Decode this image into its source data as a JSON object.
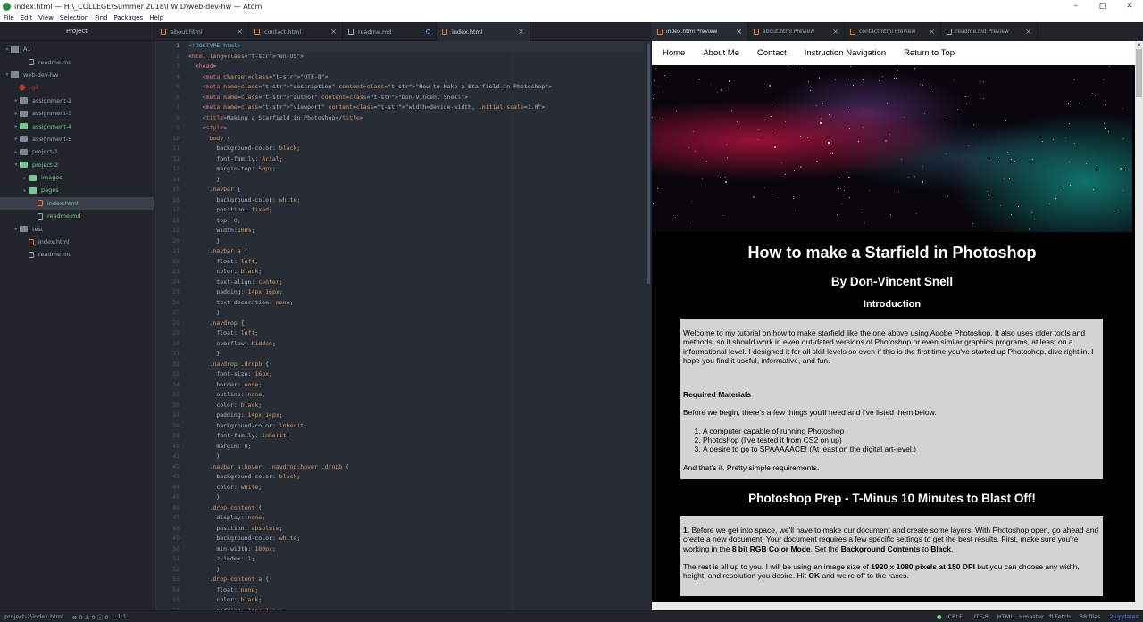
{
  "window": {
    "title": "index.html — H:\\_COLLEGE\\Summer 2018\\I W D\\web-dev-hw — Atom",
    "controls": [
      "–",
      "□",
      "✕"
    ]
  },
  "menu": [
    "File",
    "Edit",
    "View",
    "Selection",
    "Find",
    "Packages",
    "Help"
  ],
  "tree": {
    "header": "Project",
    "rows": [
      {
        "label": "A1",
        "type": "repo",
        "open": true,
        "indent": 0
      },
      {
        "label": "readme.md",
        "type": "file",
        "indent": 2
      },
      {
        "label": "web-dev-hw",
        "type": "repo",
        "open": true,
        "indent": 0
      },
      {
        "label": ".git",
        "type": "gitdir",
        "indent": 1
      },
      {
        "label": "assignment-2",
        "type": "folder",
        "indent": 1
      },
      {
        "label": "assignment-3",
        "type": "folder",
        "indent": 1
      },
      {
        "label": "assignment-4",
        "type": "folder",
        "color": "green",
        "indent": 1
      },
      {
        "label": "assignment-5",
        "type": "folder",
        "indent": 1
      },
      {
        "label": "project-1",
        "type": "folder",
        "indent": 1
      },
      {
        "label": "project-2",
        "type": "folder",
        "color": "green",
        "open": true,
        "indent": 1
      },
      {
        "label": "images",
        "type": "folder",
        "color": "green",
        "indent": 2
      },
      {
        "label": "pages",
        "type": "folder",
        "color": "green",
        "indent": 2
      },
      {
        "label": "index.html",
        "type": "htmlfile",
        "color": "green",
        "selected": true,
        "indent": 3
      },
      {
        "label": "readme.md",
        "type": "file",
        "color": "green",
        "indent": 3
      },
      {
        "label": "test",
        "type": "folder",
        "indent": 1
      },
      {
        "label": "index.html",
        "type": "htmlfile",
        "indent": 2
      },
      {
        "label": "readme.md",
        "type": "file",
        "indent": 2
      }
    ]
  },
  "editor_tabs": [
    {
      "label": "about.html",
      "kind": "html",
      "active": false,
      "modified": false
    },
    {
      "label": "contact.html",
      "kind": "html",
      "active": false,
      "modified": false
    },
    {
      "label": "readme.md",
      "kind": "md",
      "active": false,
      "modified": true
    },
    {
      "label": "index.html",
      "kind": "html",
      "active": true,
      "modified": false
    }
  ],
  "code_lines": [
    "<!DOCTYPE html>",
    "<html lang=\"en-US\">",
    "  <head>",
    "    <meta charset=\"UTF-8\">",
    "    <meta name=\"description\" content=\"How to Make a Starfield in Photoshop\">",
    "    <meta name=\"author\" content=\"Don-Vincent Snell\">",
    "    <meta name=\"viewport\" content=\"width=device-width, initial-scale=1.0\">",
    "    <title>Making a Starfield in Photoshop</title>",
    "    <style>",
    "      body {",
    "        background-color: black;",
    "        font-family: Arial;",
    "        margin-top: 50px;",
    "        }",
    "      .navbar {",
    "        background-color: white;",
    "        position: fixed;",
    "        top: 0;",
    "        width:100%;",
    "        }",
    "      .navbar a {",
    "        float: left;",
    "        color: black;",
    "        text-align: center;",
    "        padding: 14px 16px;",
    "        text-decoration: none;",
    "        }",
    "      .navdrop {",
    "        float: left;",
    "        overflow: hidden;",
    "        }",
    "      .navdrop .dropb {",
    "        font-size: 16px;",
    "        border: none;",
    "        outline: none;",
    "        color: black;",
    "        padding: 14px 14px;",
    "        background-color: inherit;",
    "        font-family: inherit;",
    "        margin: 0;",
    "        }",
    "      .navbar a:hover, .navdrop:hover .dropb {",
    "        background-color: black;",
    "        color: white;",
    "        }",
    "      .drop-content {",
    "        display: none;",
    "        position: absolute;",
    "        background-color: white;",
    "        min-width: 180px;",
    "        z-index: 1;",
    "        }",
    "      .drop-content a {",
    "        float: none;",
    "        color: black;",
    "        padding: 14px 14px;"
  ],
  "preview_tabs": [
    {
      "label": "index.html Preview",
      "kind": "html",
      "active": true
    },
    {
      "label": "about.html Preview",
      "kind": "html",
      "active": false
    },
    {
      "label": "contact.html Preview",
      "kind": "html",
      "active": false
    },
    {
      "label": "readme.md Preview",
      "kind": "md",
      "active": false
    }
  ],
  "page": {
    "nav": [
      "Home",
      "About Me",
      "Contact",
      "Instruction Navigation",
      "Return to Top"
    ],
    "title": "How to make a Starfield in Photoshop",
    "author": "By Don-Vincent Snell",
    "intro_heading": "Introduction",
    "intro_paragraph": "Welcome to my tutorial on how to make starfield like the one above using Adobe Photoshop. It also uses older tools and methods, so it should work in even out-dated versions of Photoshop or even similar graphics programs, at least on a informational level. I designed it for all skill levels so even if this is the first time you've started up Photoshop, dive right in. I hope you find it useful, informative, and fun.",
    "materials_heading": "Required Materials",
    "materials_intro": "Before we begin, there's a few things you'll need and I've listed them below.",
    "materials_list": [
      "A computer capable of running Photoshop",
      "Photoshop (I've tested it from CS2 on up)",
      "A desire to go to SPAAAAACE! (At least on the digital art-level.)"
    ],
    "materials_outro": "And that's it. Pretty simple requirements.",
    "prep_heading": "Photoshop Prep - T-Minus 10 Minutes to Blast Off!",
    "step1": {
      "num": "1.",
      "text_a": " Before we get into space, we'll have to make our document and create some layers. With Photoshop open, go ahead and create a new document. Your document requires a few specific settings to get the best results. First, make sure you're working in the ",
      "bold_a": "8 bit RGB Color Mode",
      "text_b": ". Set the ",
      "bold_b": "Background Contents",
      "text_c": " to ",
      "bold_c": "Black",
      "text_d": "."
    },
    "step1b": {
      "text_a": "The rest is all up to you. I will be using an image size of ",
      "bold_a": "1920 x 1080 pixels at 150 DPI",
      "text_b": " but you can choose any width, height, and resolution you desire. Hit ",
      "bold_b": "OK",
      "text_c": " and we're off to the races."
    }
  },
  "status": {
    "path": "project-2\\index.html",
    "issues": "⊗ 0  ⚠ 0  ⓘ 0",
    "cursor": "1:1",
    "eol": "CRLF",
    "encoding": "UTF-8",
    "grammar": "HTML",
    "branch": "master",
    "fetch": "Fetch",
    "files": "38 files",
    "updates": "2 updates"
  },
  "colors": {
    "accent": "#568af2",
    "git_added": "#73c990",
    "html_icon": "#e0783a",
    "editor_bg": "#282c34",
    "panel_bg": "#21252b"
  }
}
